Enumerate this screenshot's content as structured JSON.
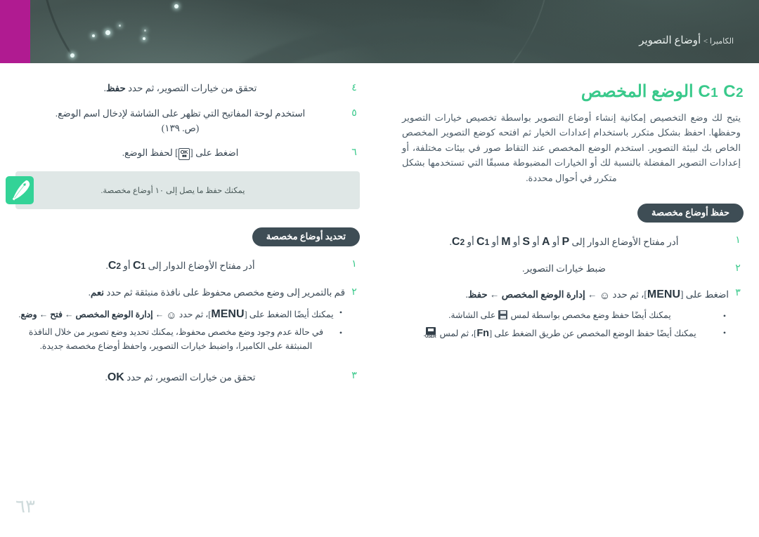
{
  "header": {
    "breadcrumb_parent": "الكاميرا >",
    "breadcrumb_current": "أوضاع التصوير",
    "tab_color": "#b01b91",
    "bg_color": "#3b4a48"
  },
  "page_number": "٦٣",
  "accent_color": "#39c98b",
  "right_column": {
    "title_latin": "C1 C2",
    "title_text": "الوضع المخصص",
    "intro": "يتيح لك وضع التخصيص إمكانية إنشاء أوضاع التصوير بواسطة تخصيص خيارات التصوير وحفظها. احفظ بشكل متكرر باستخدام إعدادات الخيار ثم افتحه كوضع التصوير المخصص الخاص بك لبيئة التصوير. استخدم الوضع المخصص عند التقاط صور في بيئات مختلفة، أو إعدادات التصوير المفضلة بالنسبة لك أو الخيارات المضبوطة مسبقًا التي تستخدمها بشكل متكرر في أحوال محددة.",
    "badge": "حفظ أوضاع مخصصة",
    "steps": [
      {
        "num": "١",
        "pre": "أدر مفتاح الأوضاع الدوار إلى",
        "modes": [
          "P",
          "A",
          "S",
          "M",
          "C1",
          "C2"
        ],
        "sep": "أو",
        "post": "."
      },
      {
        "num": "٢",
        "text": "ضبط خيارات التصوير."
      },
      {
        "num": "٣",
        "pre": "اضغط على [",
        "key": "MENU",
        "mid": "]، ثم حدد",
        "path1": "إدارة الوضع المخصص",
        "path2": "حفظ",
        "post": ".",
        "bullets": [
          {
            "pre": "يمكنك أيضًا حفظ وضع مخصص بواسطة لمس",
            "post": "على الشاشة.",
            "icon": "save-icon"
          },
          {
            "pre": "يمكنك أيضًا حفظ الوضع المخصص عن طريق الضغط على [",
            "key": "Fn",
            "mid": "]، ثم لمس",
            "post": ".",
            "icon": "save-user-icon"
          }
        ]
      }
    ]
  },
  "left_column": {
    "steps_continued": [
      {
        "num": "٤",
        "pre": "تحقق من خيارات التصوير، ثم حدد",
        "bold": "حفظ",
        "post": "."
      },
      {
        "num": "٥",
        "text": "استخدم لوحة المفاتيح التي تظهر على الشاشة لإدخال اسم الوضع.",
        "page_ref": "(ص. ١٣٩)"
      },
      {
        "num": "٦",
        "pre": "اضغط على [",
        "key": "OK",
        "post": "] لحفظ الوضع."
      }
    ],
    "note": {
      "icon": "pen-nib-icon",
      "text": "يمكنك حفظ ما يصل إلى ١٠ أوضاع مخصصة."
    },
    "badge": "تحديد أوضاع مخصصة",
    "steps": [
      {
        "num": "١",
        "pre": "أدر مفتاح الأوضاع الدوار إلى",
        "modes": [
          "C1",
          "C2"
        ],
        "sep": "أو",
        "post": "."
      },
      {
        "num": "٢",
        "pre": "قم بالتمرير إلى وضع مخصص محفوظ على نافذة منبثقة ثم حدد",
        "bold": "نعم",
        "post": ".",
        "bullets": [
          {
            "pre": "يمكنك أيضًا الضغط على [",
            "key": "MENU",
            "mid": "]، ثم حدد",
            "path1": "إدارة الوضع المخصص",
            "path2": "فتح",
            "path3": "وضع",
            "post": "."
          },
          {
            "text": "في حالة عدم وجود وضع مخصص محفوظ، يمكنك تحديد وضع تصوير من خلال النافذة المنبثقة على الكاميرا، واضبط خيارات التصوير، واحفظ أوضاع مخصصة جديدة."
          }
        ]
      },
      {
        "num": "٣",
        "pre": "تحقق من خيارات التصوير، ثم حدد",
        "key": "OK",
        "post": "."
      }
    ]
  }
}
